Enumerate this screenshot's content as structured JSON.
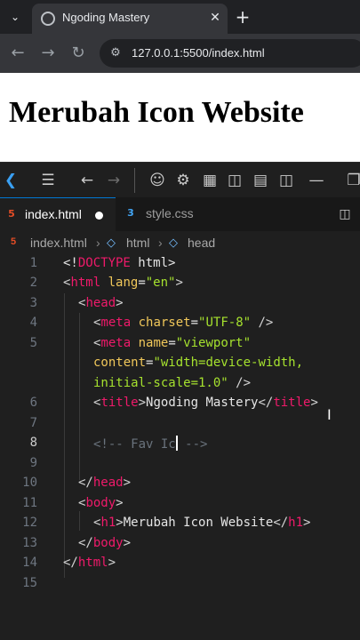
{
  "browser": {
    "tab_title": "Ngoding Mastery",
    "url": "127.0.0.1:5500/index.html",
    "icons": {
      "tab_list": "chevron-down-icon",
      "favicon": "globe-icon",
      "close": "close-icon",
      "new_tab": "plus-icon",
      "back": "arrow-left-icon",
      "forward": "arrow-right-icon",
      "reload": "reload-icon",
      "site_info": "tune-icon"
    }
  },
  "webpage": {
    "heading": "Merubah Icon Website"
  },
  "vscode": {
    "tabs": [
      {
        "label": "index.html",
        "icon": "html5-icon",
        "dirty": true
      },
      {
        "label": "style.css",
        "icon": "css3-icon"
      }
    ],
    "breadcrumb": [
      "index.html",
      "html",
      "head"
    ],
    "line_numbers": [
      "1",
      "2",
      "3",
      "4",
      "5",
      "",
      "",
      "6",
      "7",
      "8",
      "9",
      "10",
      "11",
      "12",
      "13",
      "14",
      "15"
    ],
    "current_line": "8",
    "code": {
      "l1_doctype": "<!",
      "l1_kw": "DOCTYPE",
      "l1_name": " html",
      "l1_close": ">",
      "l2_tag": "html",
      "l2_attr": "lang",
      "l2_val": "\"en\"",
      "l3_tag": "head",
      "l4_tag": "meta",
      "l4_attr": "charset",
      "l4_val": "\"UTF-8\"",
      "l4_close": " />",
      "l5_tag": "meta",
      "l5_attr": "name",
      "l5_val": "\"viewport\"",
      "l5b_attr": "content",
      "l5b_val": "\"width=device-width,",
      "l5c_val": "initial-scale=1.0\"",
      "l5c_close": " />",
      "l6_tag": "title",
      "l6_text": "Ngoding Mastery",
      "l6_end": "title",
      "l8_comment_a": "<!-- Fav Ic",
      "l8_comment_b": " -->",
      "l10_tag": "head",
      "l11_tag": "body",
      "l12_tag": "h1",
      "l12_text": "Merubah Icon Website",
      "l12_end": "h1",
      "l13_tag": "body",
      "l14_tag": "html"
    }
  },
  "colors": {
    "tag": "#ef1a6a",
    "attribute": "#f0c75a",
    "string": "#a6e22e",
    "comment": "#6a737d",
    "editor_bg": "#1f1f1f",
    "accent": "#0078d4"
  }
}
